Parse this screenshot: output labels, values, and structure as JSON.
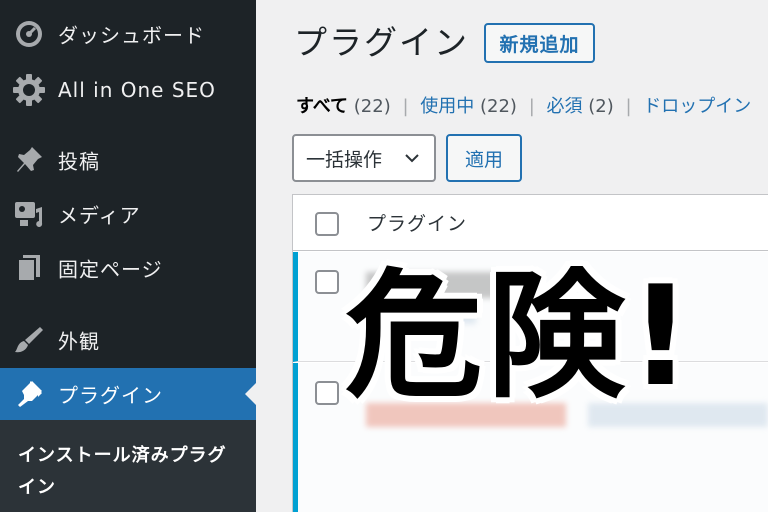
{
  "sidebar": {
    "items": [
      {
        "label": "ダッシュボード",
        "icon": "dashboard-icon"
      },
      {
        "label": "All in One SEO",
        "icon": "gear-icon"
      },
      {
        "label": "投稿",
        "icon": "pin-icon"
      },
      {
        "label": "メディア",
        "icon": "media-icon"
      },
      {
        "label": "固定ページ",
        "icon": "page-icon"
      },
      {
        "label": "外観",
        "icon": "brush-icon"
      },
      {
        "label": "プラグイン",
        "icon": "plugin-icon"
      }
    ],
    "submenu_label": "インストール済みプラグイン"
  },
  "header": {
    "title": "プラグイン",
    "add_new_label": "新規追加"
  },
  "filters": {
    "all_label": "すべて",
    "all_count": "(22)",
    "active_label": "使用中",
    "active_count": "(22)",
    "mustuse_label": "必須",
    "mustuse_count": "(2)",
    "dropin_label": "ドロップイン"
  },
  "bulk": {
    "select_value": "一括操作",
    "apply_label": "適用"
  },
  "table": {
    "column_header": "プラグイン"
  },
  "overlay": {
    "text": "危険!"
  },
  "colors": {
    "sidebar_bg": "#1d2327",
    "accent": "#2271b1",
    "active_row_border": "#00a0d2"
  }
}
